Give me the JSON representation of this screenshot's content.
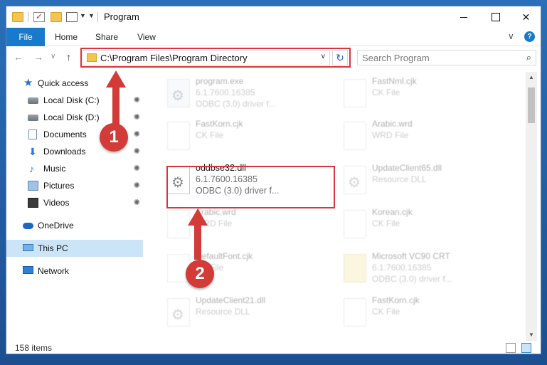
{
  "window": {
    "title": "Program",
    "controls": {
      "minimize": "",
      "maximize": "",
      "close": "✕"
    }
  },
  "ribbon": {
    "tabs": [
      "File",
      "Home",
      "Share",
      "View"
    ],
    "expand": "∨",
    "help": "?"
  },
  "nav": {
    "back": "←",
    "forward": "→",
    "recent": "∨",
    "up": "↑",
    "address": "C:\\Program Files\\Program Directory",
    "address_dropdown": "∨",
    "refresh": "↻",
    "search_placeholder": "Search Program",
    "search_icon": "⌕"
  },
  "sidebar": {
    "items": [
      {
        "label": "Quick access",
        "icon": "star-icon",
        "pinned": false
      },
      {
        "label": "Local Disk (C:)",
        "icon": "drive-icon",
        "pinned": true
      },
      {
        "label": "Local Disk (D:)",
        "icon": "drive-icon",
        "pinned": true
      },
      {
        "label": "Documents",
        "icon": "documents-icon",
        "pinned": true
      },
      {
        "label": "Downloads",
        "icon": "downloads-icon",
        "pinned": true
      },
      {
        "label": "Music",
        "icon": "music-icon",
        "pinned": true
      },
      {
        "label": "Pictures",
        "icon": "pictures-icon",
        "pinned": true
      },
      {
        "label": "Videos",
        "icon": "videos-icon",
        "pinned": true
      },
      {
        "label": "OneDrive",
        "icon": "onedrive-icon",
        "pinned": false
      },
      {
        "label": "This PC",
        "icon": "pc-icon",
        "pinned": false
      },
      {
        "label": "Network",
        "icon": "network-icon",
        "pinned": false
      }
    ],
    "pin_glyph": "📌"
  },
  "files": [
    {
      "name": "program.exe",
      "line2": "6.1.7600.16385",
      "line3": "ODBC (3.0) driver f...",
      "icon": "exe"
    },
    {
      "name": "FastNml.cjk",
      "line2": "CK File",
      "line3": "",
      "icon": "doc"
    },
    {
      "name": "FastKorn.cjk",
      "line2": "CK File",
      "line3": "",
      "icon": "doc"
    },
    {
      "name": "Arabic.wrd",
      "line2": "WRD File",
      "line3": "",
      "icon": "doc"
    },
    {
      "name": "oddbse32.dll",
      "line2": "6.1.7600.16385",
      "line3": "ODBC (3.0) driver f...",
      "icon": "gear"
    },
    {
      "name": "UpdateClient65.dll",
      "line2": "Resource DLL",
      "line3": "",
      "icon": "gear"
    },
    {
      "name": "Arabic.wrd",
      "line2": "WRD File",
      "line3": "",
      "icon": "doc"
    },
    {
      "name": "Korean.cjk",
      "line2": "CK File",
      "line3": "",
      "icon": "doc"
    },
    {
      "name": "DefaultFont.cjk",
      "line2": "CK File",
      "line3": "",
      "icon": "doc"
    },
    {
      "name": "Microsoft VC90 CRT",
      "line2": "6.1.7600.16385",
      "line3": "ODBC (3.0) driver f...",
      "icon": "vc"
    },
    {
      "name": "UpdateClient21.dll",
      "line2": "Resource DLL",
      "line3": "",
      "icon": "gear"
    },
    {
      "name": "FastKorn.cjk",
      "line2": "CK File",
      "line3": "",
      "icon": "doc"
    }
  ],
  "status": {
    "items": "158 items"
  },
  "callouts": [
    "1",
    "2"
  ],
  "colors": {
    "accent": "#1979ca",
    "highlight": "#d8363a",
    "selected": "#cce4f7"
  }
}
